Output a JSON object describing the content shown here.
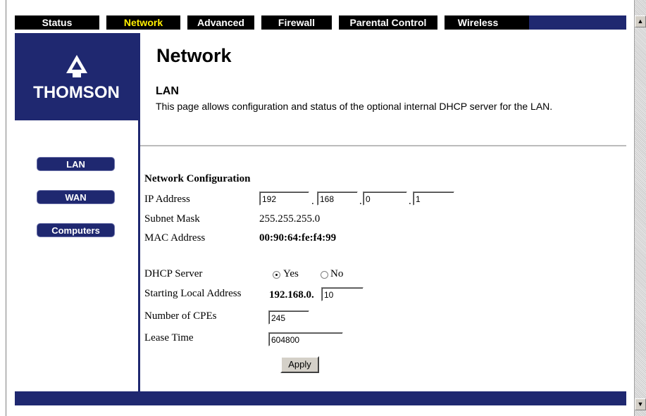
{
  "nav": {
    "tabs": [
      {
        "label": "Status"
      },
      {
        "label": "Network"
      },
      {
        "label": "Advanced"
      },
      {
        "label": "Firewall"
      },
      {
        "label": "Parental Control"
      },
      {
        "label": "Wireless"
      }
    ],
    "active_tab": "Network"
  },
  "brand": {
    "name": "THOMSON"
  },
  "sidebar": {
    "items": [
      {
        "label": "LAN"
      },
      {
        "label": "WAN"
      },
      {
        "label": "Computers"
      }
    ]
  },
  "page": {
    "title": "Network",
    "subtitle": "LAN",
    "description": "This page allows configuration and status of the optional internal DHCP server for the LAN."
  },
  "config": {
    "heading": "Network Configuration",
    "ip_label": "IP Address",
    "ip_octets": [
      "192",
      "168",
      "0",
      "1"
    ],
    "subnet_label": "Subnet Mask",
    "subnet_value": "255.255.255.0",
    "mac_label": "MAC Address",
    "mac_value": "00:90:64:fe:f4:99",
    "dhcp_label": "DHCP Server",
    "dhcp_yes": "Yes",
    "dhcp_no": "No",
    "dhcp_selected": "Yes",
    "start_label": "Starting Local Address",
    "start_prefix": "192.168.0.",
    "start_value": "10",
    "cpes_label": "Number of CPEs",
    "cpes_value": "245",
    "lease_label": "Lease Time",
    "lease_value": "604800",
    "apply_label": "Apply"
  },
  "colors": {
    "brand_blue": "#1f2870",
    "active_tab": "#ffee00"
  }
}
